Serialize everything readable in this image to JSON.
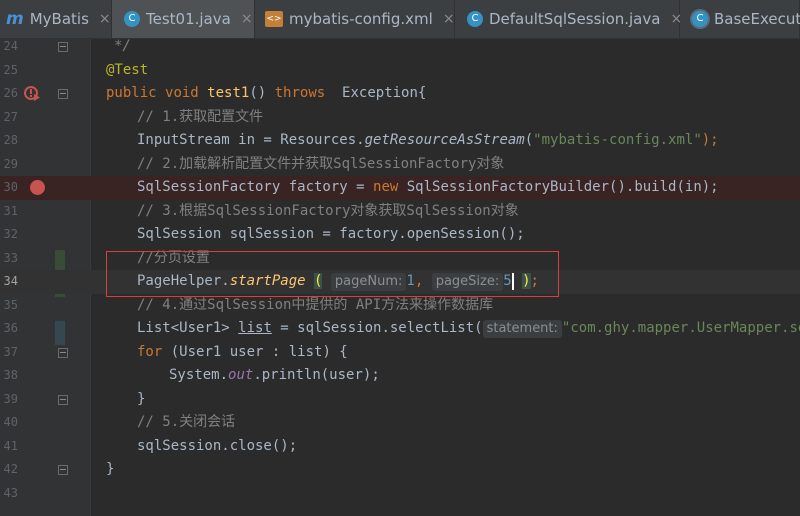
{
  "tabs": [
    {
      "label": "MyBatis",
      "icon": "maven-m-icon",
      "active": false
    },
    {
      "label": "Test01.java",
      "icon": "java-class-icon",
      "active": true
    },
    {
      "label": "mybatis-config.xml",
      "icon": "xml-file-icon",
      "active": false
    },
    {
      "label": "DefaultSqlSession.java",
      "icon": "java-class-icon",
      "active": false
    },
    {
      "label": "BaseExecuto",
      "icon": "java-class-icon",
      "active": false
    }
  ],
  "close_glyph": "×",
  "line_numbers": [
    "24",
    "25",
    "26",
    "27",
    "28",
    "29",
    "30",
    "31",
    "32",
    "33",
    "34",
    "35",
    "36",
    "37",
    "38",
    "39",
    "40",
    "41",
    "42",
    "43"
  ],
  "code": {
    "l24": "*/",
    "l25_ann": "@Test",
    "l26_kw1": "public",
    "l26_kw2": "void",
    "l26_fn": "test1",
    "l26_parens": "()",
    "l26_kw3": "throws",
    "l26_rest": "  Exception{",
    "l27": "// 1.获取配置文件",
    "l28_a": "InputStream in = Resources.",
    "l28_m": "getResourceAsStream",
    "l28_b": "(",
    "l28_s": "\"mybatis-config.xml\"",
    "l28_c": ");",
    "l29": "// 2.加载解析配置文件并获取SqlSessionFactory对象",
    "l30_a": "SqlSessionFactory factory = ",
    "l30_kw": "new",
    "l30_b": " SqlSessionFactoryBuilder().build(in);",
    "l31": "// 3.根据SqlSessionFactory对象获取SqlSession对象",
    "l32": "SqlSession sqlSession = factory.openSession();",
    "l33": "//分页设置",
    "l34_a": "PageHelper.",
    "l34_m": "startPage",
    "l34_open": "(",
    "l34_h1": "pageNum:",
    "l34_v1": "1",
    "l34_comma": ",",
    "l34_h2": "pageSize:",
    "l34_v2": "5",
    "l34_close": ")",
    "l34_semi": ";",
    "l35": "// 4.通过SqlSession中提供的 API方法来操作数据库",
    "l36_a": "List<User1> ",
    "l36_var": "list",
    "l36_b": " = sqlSession.selectList(",
    "l36_hint": "statement:",
    "l36_s": "\"com.ghy.mapper.UserMapper.sele",
    "l37_kw": "for",
    "l37_rest": " (User1 user : list) {",
    "l38_a": "System.",
    "l38_fld": "out",
    "l38_b": ".println(user);",
    "l39": "}",
    "l40": "// 5.关闭会话",
    "l41": "sqlSession.close();",
    "l42": "}"
  },
  "colors": {
    "background": "#2b2b2b",
    "keyword": "#cc7832",
    "method": "#ffc66d",
    "comment": "#808080",
    "string": "#6a8759",
    "annotation": "#bbb529",
    "number": "#6897bb",
    "breakpoint": "#c75450",
    "highlight_box": "#d84040"
  }
}
